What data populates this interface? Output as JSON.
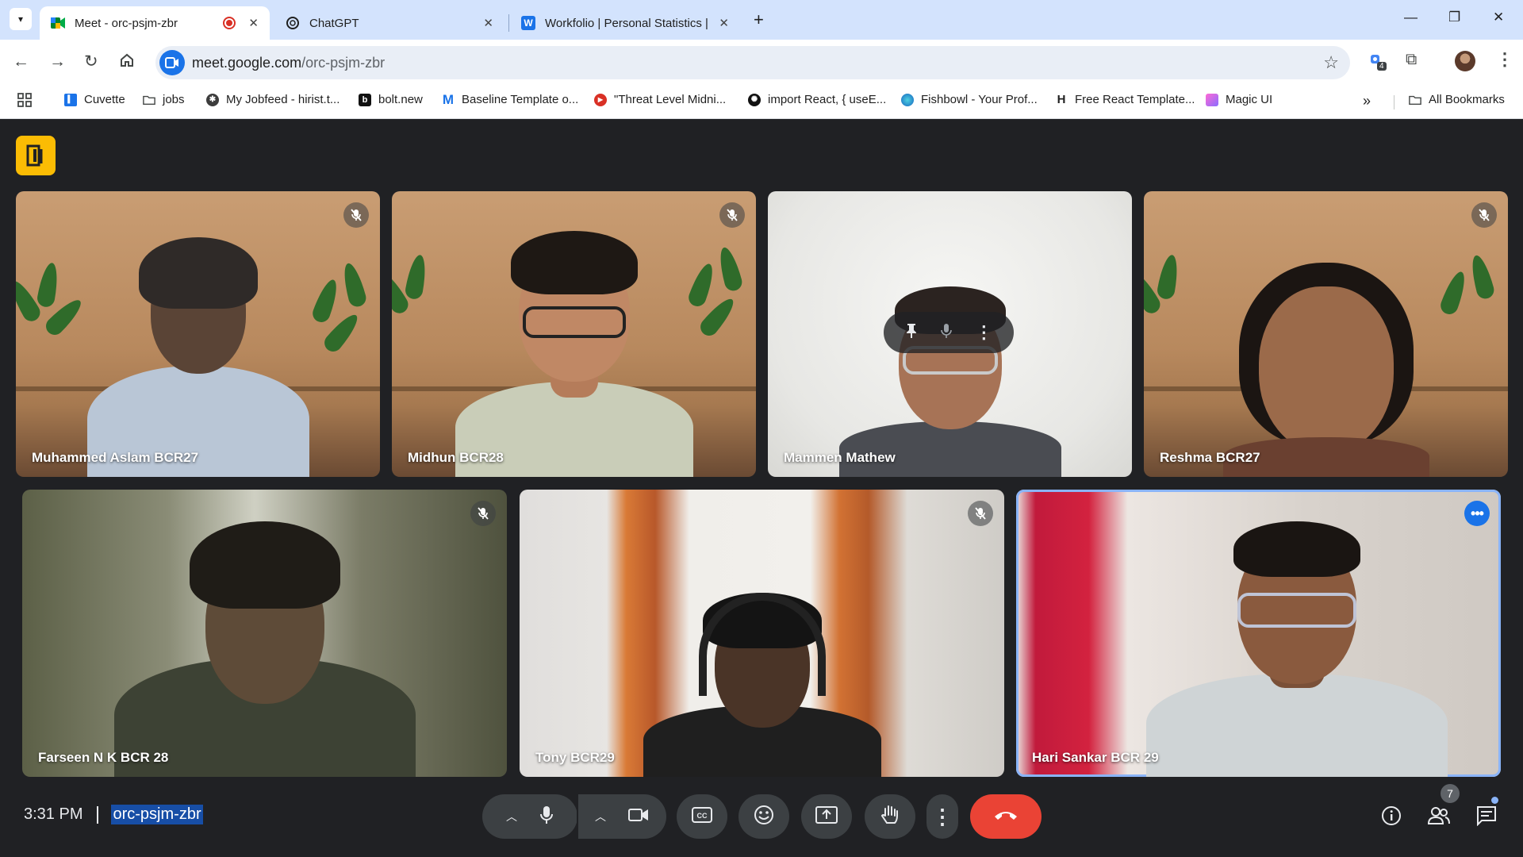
{
  "browser": {
    "tabs": [
      {
        "title": "Meet - orc-psjm-zbr",
        "active": true,
        "recording": true
      },
      {
        "title": "ChatGPT",
        "active": false
      },
      {
        "title": "Workfolio | Personal Statistics | (",
        "active": false
      }
    ],
    "new_tab_symbol": "+",
    "url_host": "meet.google.com",
    "url_path": "/orc-psjm-zbr",
    "extension_badge": "4",
    "bookmarks": [
      {
        "label": "Cuvette",
        "icon": "cuvette-icon"
      },
      {
        "label": "jobs",
        "icon": "folder-icon"
      },
      {
        "label": "My Jobfeed - hirist.t...",
        "icon": "hirist-icon"
      },
      {
        "label": "bolt.new",
        "icon": "bolt-icon"
      },
      {
        "label": "Baseline Template o...",
        "icon": "baseline-m-icon"
      },
      {
        "label": "\"Threat Level Midni...",
        "icon": "youtube-icon"
      },
      {
        "label": "import React, { useE...",
        "icon": "openai-icon"
      },
      {
        "label": "Fishbowl - Your Prof...",
        "icon": "fishbowl-icon"
      },
      {
        "label": "Free React Template...",
        "icon": "h-icon"
      },
      {
        "label": "Magic UI",
        "icon": "magicui-icon"
      }
    ],
    "all_bookmarks_label": "All Bookmarks",
    "colors": {
      "tabstrip": "#d3e3fd",
      "omnibox": "#e9eef6",
      "accent": "#1a73e8"
    }
  },
  "meet": {
    "participants": [
      {
        "name": "Muhammed Aslam BCR27",
        "muted": true
      },
      {
        "name": "Midhun BCR28",
        "muted": true
      },
      {
        "name": "Mammen Mathew",
        "muted": false,
        "hovered": true
      },
      {
        "name": "Reshma BCR27",
        "muted": true
      },
      {
        "name": "Farseen N K BCR 28",
        "muted": true
      },
      {
        "name": "Tony BCR29",
        "muted": true
      },
      {
        "name": "Hari Sankar BCR 29",
        "muted": false,
        "speaking": true
      }
    ],
    "time": "3:31 PM",
    "meeting_code": "orc-psjm-zbr",
    "people_count": "7",
    "controls": [
      "mic-options",
      "microphone",
      "camera-options",
      "camera",
      "captions",
      "emoji-reactions",
      "present-screen",
      "raise-hand",
      "more-options",
      "leave-call"
    ],
    "side_controls": [
      "meeting-info",
      "people",
      "chat"
    ],
    "colors": {
      "background": "#202124",
      "control": "#3c4043",
      "end_call": "#ea4335",
      "speaking_outline": "#8ab4f8",
      "logo": "#fbbc04"
    }
  }
}
